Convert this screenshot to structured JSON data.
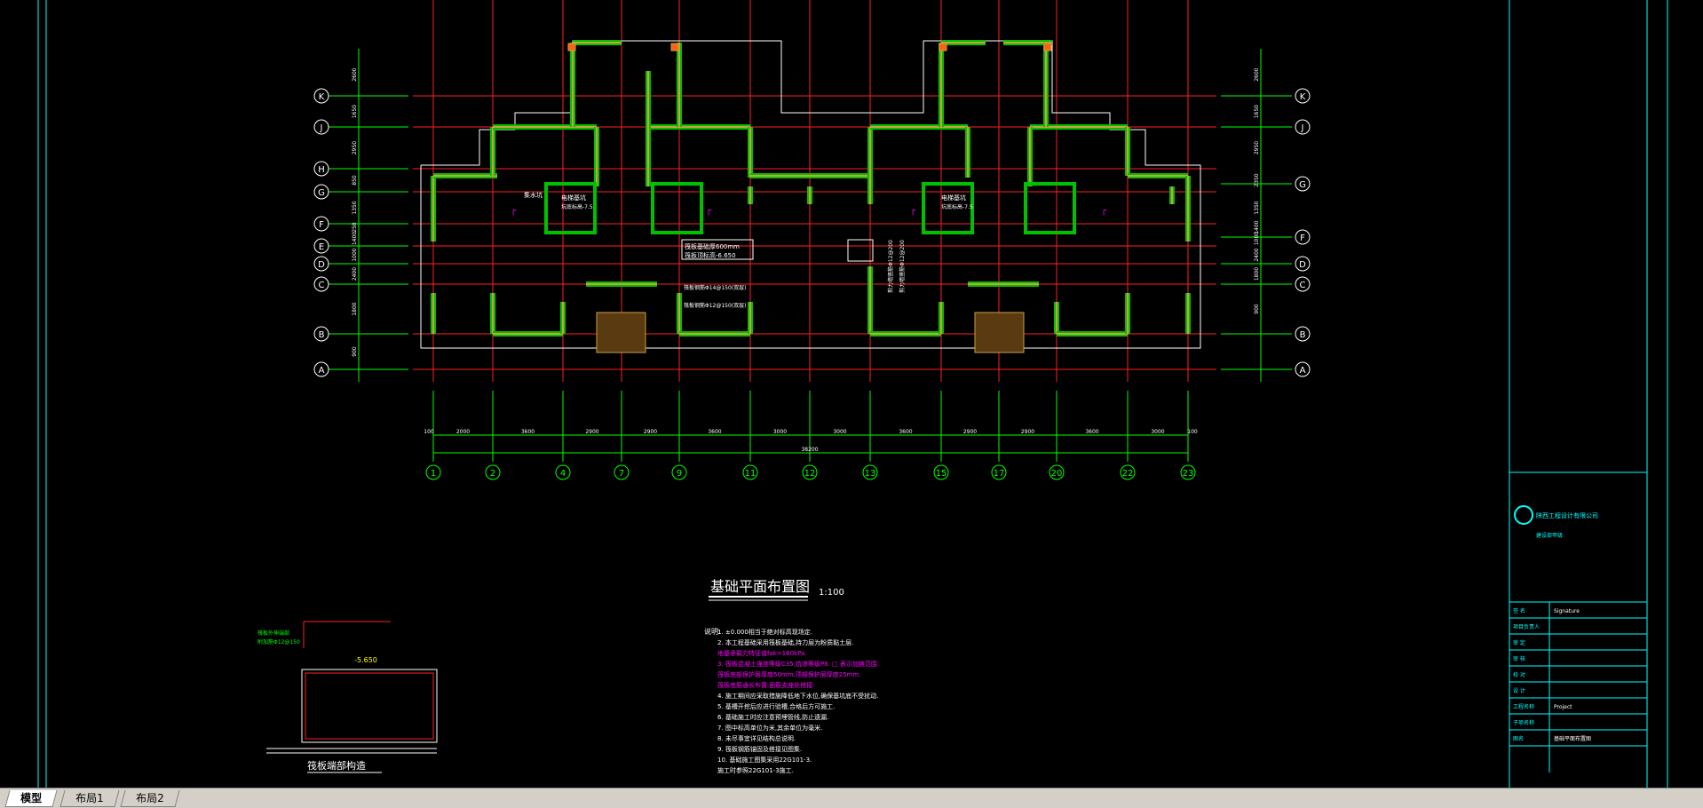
{
  "drawing": {
    "title": "基础平面布置图",
    "scale": "1:100",
    "callouts": {
      "slab_thickness": "筏板基础厚600mm",
      "slab_level": "筏板顶标高-6.650",
      "pit1": "电梯基坑",
      "pit1_level": "坑底标高-7.5",
      "pit_box": "集水坑",
      "beam1": "筏板钢筋Φ14@150(双层)",
      "beam2": "筏板钢筋Φ12@150(双层)",
      "vertical1": "剪力墙竖筋Φ12@200",
      "vertical2": "剪力墙竖筋Φ12@200"
    }
  },
  "grid_rows": [
    "K",
    "J",
    "H",
    "G",
    "F",
    "E",
    "D",
    "C",
    "B",
    "A"
  ],
  "grid_rows_right": [
    "K",
    "J",
    "G",
    "F",
    "D",
    "C",
    "B",
    "A"
  ],
  "grid_cols": [
    "1",
    "2",
    "4",
    "7",
    "9",
    "11",
    "12",
    "13",
    "15",
    "17",
    "20",
    "22",
    "23"
  ],
  "dims_bottom": [
    "100",
    "2000",
    "3600",
    "2900",
    "2900",
    "3600",
    "3000",
    "3000",
    "3600",
    "2900",
    "2900",
    "3600",
    "3000",
    "100"
  ],
  "dim_total": "38200",
  "dims_left": [
    "2600",
    "1650",
    "2950",
    "850",
    "1350",
    "250",
    "1400",
    "1000",
    "2400",
    "1800",
    "900"
  ],
  "dims_right": [
    "2600",
    "1650",
    "2950",
    "2350",
    "1350",
    "1400",
    "1000",
    "2400",
    "1800",
    "900"
  ],
  "section": {
    "title": "筏板端部构造",
    "level": "-5.650",
    "note1": "筏板外伸端部",
    "note2": "附加筋Φ12@150"
  },
  "notes": {
    "heading": "说明:",
    "items": [
      "1. ±0.000相当于绝对标高现场定.",
      "2. 本工程基础采用筏板基础,持力层为粉质黏土层.",
      "   地基承载力特征值fak=180kPa.",
      "3. 筏板混凝土强度等级C35,抗渗等级P6.   □ 表示加腋范围.",
      "   筏板底部保护层厚度50mm,顶部保护层厚度25mm.",
      "   筏板底筋通长布置,面筋支座处搭接.",
      "4. 施工期间应采取措施降低地下水位,确保基坑底不受扰动.",
      "5. 基槽开挖后应进行验槽,合格后方可施工.",
      "6. 基础施工时应注意预埋管线,防止遗漏.",
      "7. 图中标高单位为米,其余单位为毫米.",
      "8. 未尽事宜详见结构总说明.",
      "9. 筏板钢筋锚固及搭接见图集.",
      "10. 基础施工图集采用22G101-3.",
      "   施工时参照22G101-3施工."
    ]
  },
  "title_block": {
    "company": "陕西工程设计有限公司",
    "cert": "建设部甲级",
    "labels": [
      "签 名",
      "项目负责人",
      "审 定",
      "审 核",
      "校 对",
      "设 计",
      "工程名称",
      "子项名称",
      "图名"
    ],
    "values": [
      "Signature",
      "",
      "",
      "",
      "",
      "",
      "Project",
      "",
      "基础平面布置图"
    ]
  },
  "tabs": [
    "模型",
    "布局1",
    "布局2"
  ],
  "colors": {
    "grid_red": "#ff2020",
    "dim_green": "#00ff00",
    "wall_green": "#00c000",
    "wall_fill": "#c8a040",
    "white": "#ffffff",
    "cyan": "#00ffff",
    "magenta": "#ff00ff",
    "yellow": "#ffff00"
  }
}
